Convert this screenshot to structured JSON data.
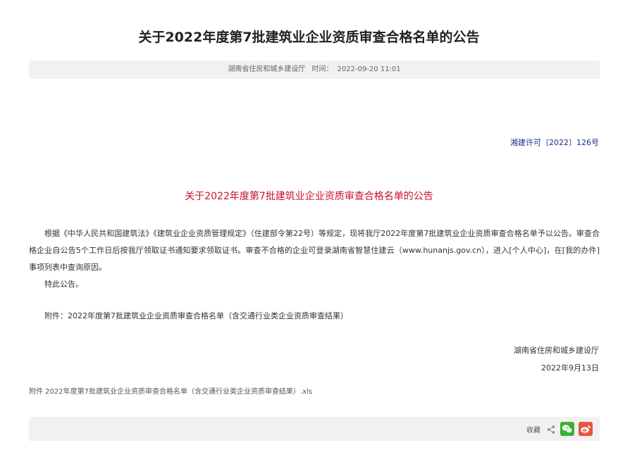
{
  "article": {
    "title": "关于2022年度第7批建筑业企业资质审查合格名单的公告",
    "meta": {
      "source": "湖南省住房和城乡建设厅",
      "time_label": "时间：",
      "time_value": "2022-09-20 11:01"
    },
    "doc_number": "湘建许可〔2022〕126号",
    "subtitle": "关于2022年度第7批建筑业企业资质审查合格名单的公告",
    "paragraph1": "根据《中华人民共和国建筑法》《建筑业企业资质管理规定》（住建部令第22号）等规定，现将我厅2022年度第7批建筑业企业资质审查合格名单予以公告。审查合格企业自公告5个工作日后按我厅领取证书通知要求领取证书。审查不合格的企业可登录湖南省智慧住建云（www.hunanjs.gov.cn），进入[个人中心]，在[我的办件]事项列表中查询原因。",
    "paragraph2": "特此公告。",
    "attachment_line": "附件：2022年度第7批建筑业企业资质审查合格名单（含交通行业类企业资质审查结果）",
    "signature_org": "湖南省住房和城乡建设厅",
    "signature_date": "2022年9月13日",
    "attachment_file": "附件 2022年度第7批建筑业企业资质审查合格名单（含交通行业类企业资质审查结果）.xls"
  },
  "footer": {
    "favorite_label": "收藏",
    "icons": [
      "share-icon",
      "wechat-icon",
      "weibo-icon"
    ]
  },
  "colors": {
    "doc_number": "#1a2e8c",
    "subtitle": "#c8102e",
    "wechat": "#3cb034",
    "weibo": "#e4573f"
  }
}
